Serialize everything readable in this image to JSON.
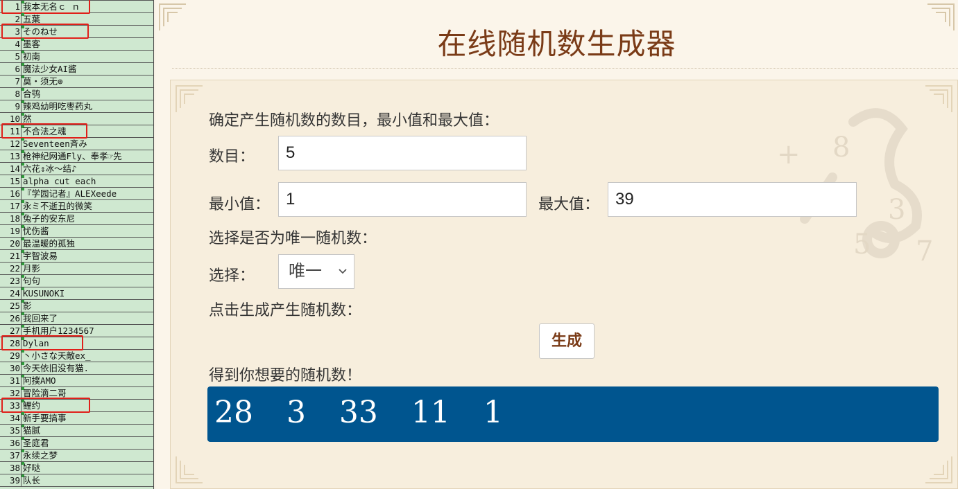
{
  "name_list": [
    {
      "num": "1",
      "name": "我本无名ｃ ｎ",
      "highlighted": true
    },
    {
      "num": "2",
      "name": "五葉",
      "highlighted": false
    },
    {
      "num": "3",
      "name": "そのねせ",
      "highlighted": true
    },
    {
      "num": "4",
      "name": "墨客",
      "highlighted": false
    },
    {
      "num": "5",
      "name": "初南",
      "highlighted": false
    },
    {
      "num": "6",
      "name": "魔法少女AI酱",
      "highlighted": false
    },
    {
      "num": "7",
      "name": "莫・须无⊕",
      "highlighted": false
    },
    {
      "num": "8",
      "name": "合鸮",
      "highlighted": false
    },
    {
      "num": "9",
      "name": "辣鸡幼明吃枣药丸",
      "highlighted": false
    },
    {
      "num": "10",
      "name": "然",
      "highlighted": false
    },
    {
      "num": "11",
      "name": "不合法之魂",
      "highlighted": true
    },
    {
      "num": "12",
      "name": "Seventeen斉み",
      "highlighted": false
    },
    {
      "num": "13",
      "name": "枪神纪网通Fly、奉孝☞先",
      "highlighted": false
    },
    {
      "num": "14",
      "name": "六花⇕冰～结♪",
      "highlighted": false
    },
    {
      "num": "15",
      "name": "alpha cut each",
      "highlighted": false
    },
    {
      "num": "16",
      "name": "『学园记者』ALEXeede",
      "highlighted": false
    },
    {
      "num": "17",
      "name": "永ミ不逝丑的微笑",
      "highlighted": false
    },
    {
      "num": "18",
      "name": "兔子的安东尼",
      "highlighted": false
    },
    {
      "num": "19",
      "name": "忧伤酱",
      "highlighted": false
    },
    {
      "num": "20",
      "name": "最温暖的孤独",
      "highlighted": false
    },
    {
      "num": "21",
      "name": "宇智波易",
      "highlighted": false
    },
    {
      "num": "22",
      "name": "月影",
      "highlighted": false
    },
    {
      "num": "23",
      "name": "句句",
      "highlighted": false
    },
    {
      "num": "24",
      "name": "KUSUNOKI",
      "highlighted": false
    },
    {
      "num": "25",
      "name": "影",
      "highlighted": false
    },
    {
      "num": "26",
      "name": "我回来了",
      "highlighted": false
    },
    {
      "num": "27",
      "name": "手机用户1234567",
      "highlighted": false
    },
    {
      "num": "28",
      "name": "Dylan",
      "highlighted": true
    },
    {
      "num": "29",
      "name": "丶小さな天敵ex_",
      "highlighted": false
    },
    {
      "num": "30",
      "name": "今天依旧没有猫.",
      "highlighted": false
    },
    {
      "num": "31",
      "name": "阿撲AMO",
      "highlighted": false
    },
    {
      "num": "32",
      "name": "冒险滴二哥",
      "highlighted": false
    },
    {
      "num": "33",
      "name": "鲤约",
      "highlighted": true
    },
    {
      "num": "34",
      "name": "新手要搞事",
      "highlighted": false
    },
    {
      "num": "35",
      "name": "猫腻",
      "highlighted": false
    },
    {
      "num": "36",
      "name": "圣庭君",
      "highlighted": false
    },
    {
      "num": "37",
      "name": "永续之梦",
      "highlighted": false
    },
    {
      "num": "38",
      "name": "好哒",
      "highlighted": false
    },
    {
      "num": "39",
      "name": "队长",
      "highlighted": false
    }
  ],
  "page": {
    "title": "在线随机数生成器",
    "accent_color": "#7a3b17",
    "result_bg_color": "#00558f",
    "highlight_color": "#e0201a"
  },
  "form": {
    "intro_label": "确定产生随机数的数目，最小值和最大值：",
    "count_label": "数目：",
    "count_value": "5",
    "min_label": "最小值：",
    "min_value": "1",
    "max_label": "最大值：",
    "max_value": "39",
    "unique_intro_label": "选择是否为唯一随机数：",
    "select_label": "选择：",
    "select_value": "唯一",
    "generate_intro_label": "点击生成产生随机数：",
    "generate_button": "生成",
    "result_label": "得到你想要的随机数！",
    "result_value": "28  3  33  11  1"
  }
}
